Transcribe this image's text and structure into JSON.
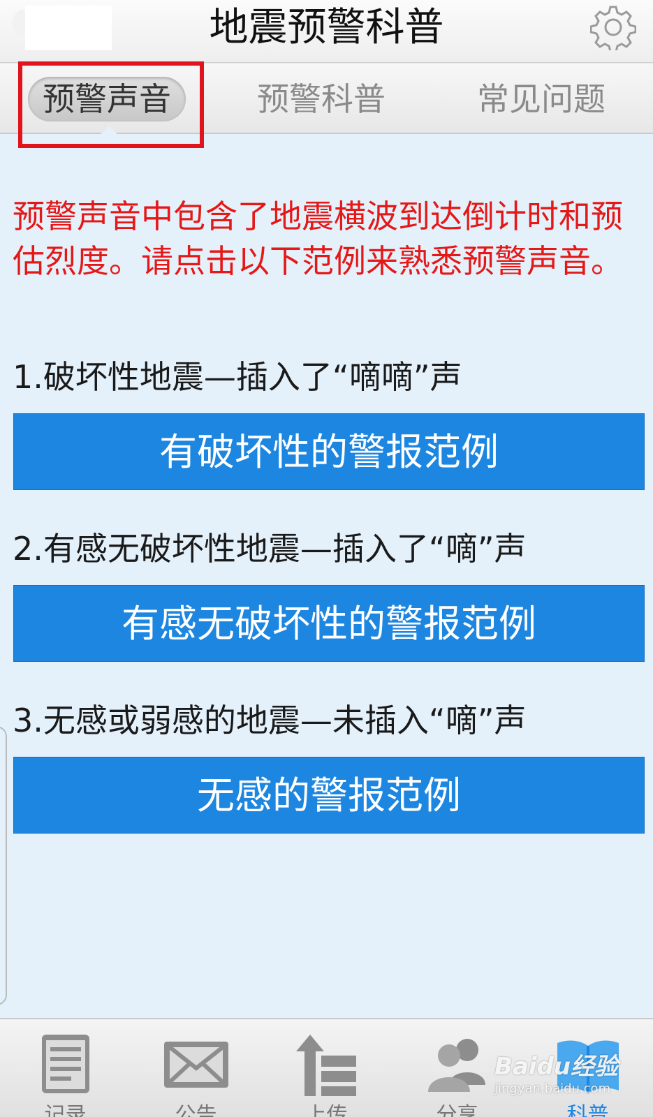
{
  "header": {
    "title": "地震预警科普",
    "settings_icon": "gear-icon"
  },
  "tabs": [
    {
      "label": "预警声音",
      "active": true
    },
    {
      "label": "预警科普",
      "active": false
    },
    {
      "label": "常见问题",
      "active": false
    }
  ],
  "main": {
    "intro": "预警声音中包含了地震横波到达倒计时和预估烈度。请点击以下范例来熟悉预警声音。",
    "items": [
      {
        "label": "1.破坏性地震—插入了“嘀嘀”声",
        "button": "有破坏性的警报范例"
      },
      {
        "label": "2.有感无破坏性地震—插入了“嘀”声",
        "button": "有感无破坏性的警报范例"
      },
      {
        "label": "3.无感或弱感的地震—未插入“嘀”声",
        "button": "无感的警报范例"
      }
    ]
  },
  "bottom_nav": [
    {
      "label": "记录",
      "icon": "record-icon"
    },
    {
      "label": "公告",
      "icon": "mail-icon"
    },
    {
      "label": "上传",
      "icon": "upload-icon"
    },
    {
      "label": "分享",
      "icon": "share-users-icon"
    },
    {
      "label": "科普",
      "icon": "book-icon",
      "active": true
    }
  ],
  "watermark": {
    "main": "Baidu经验",
    "sub": "jingyan.baidu.com"
  },
  "colors": {
    "accent": "#1d86e0",
    "intro_text": "#e51818",
    "highlight": "#e0141c",
    "background": "#e4f1fb"
  }
}
